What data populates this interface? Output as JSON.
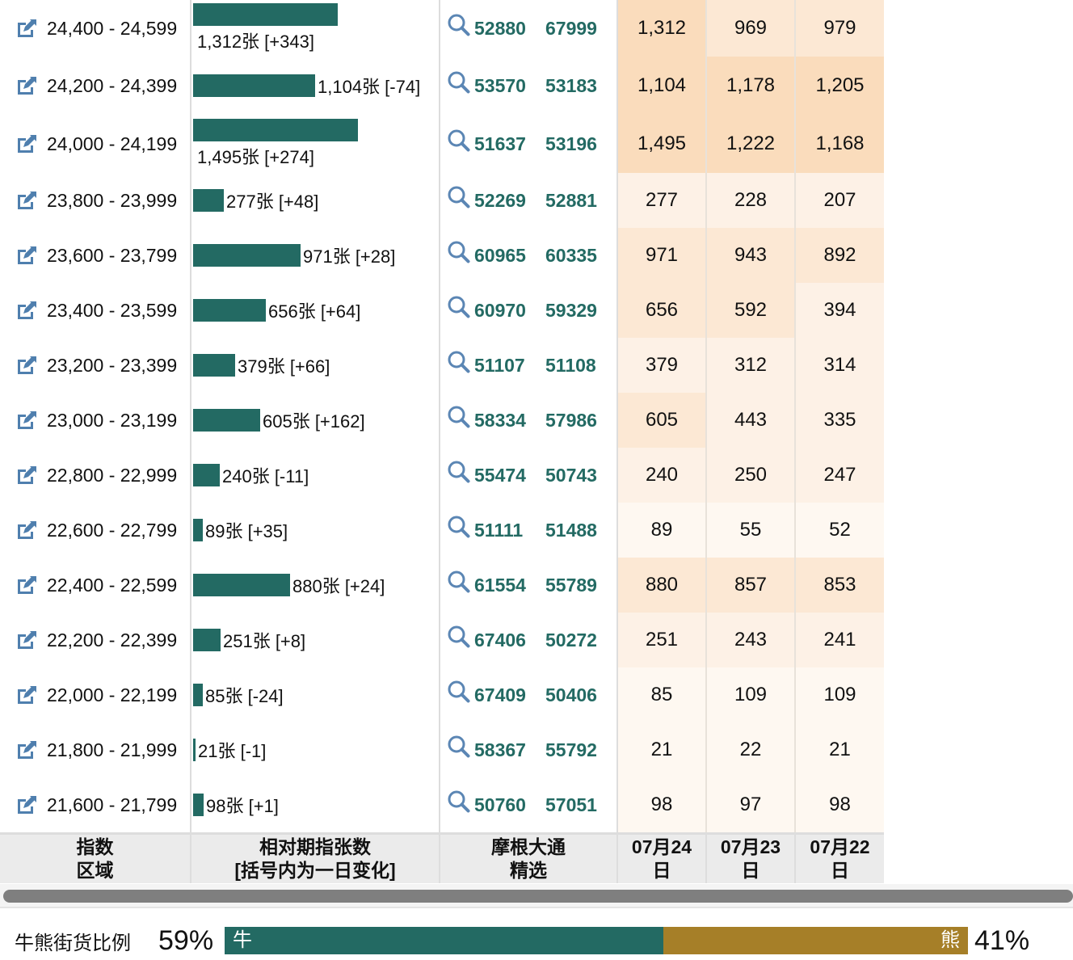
{
  "rows": [
    {
      "range": "24,400 - 24,599",
      "count": 1312,
      "label": "1,312张 [+343]",
      "code1": "52880",
      "code2": "67999",
      "d1": "1,312",
      "d2": "969",
      "d3": "979"
    },
    {
      "range": "24,200 - 24,399",
      "count": 1104,
      "label": "1,104张 [-74]",
      "code1": "53570",
      "code2": "53183",
      "d1": "1,104",
      "d2": "1,178",
      "d3": "1,205"
    },
    {
      "range": "24,000 - 24,199",
      "count": 1495,
      "label": "1,495张 [+274]",
      "code1": "51637",
      "code2": "53196",
      "d1": "1,495",
      "d2": "1,222",
      "d3": "1,168"
    },
    {
      "range": "23,800 - 23,999",
      "count": 277,
      "label": "277张 [+48]",
      "code1": "52269",
      "code2": "52881",
      "d1": "277",
      "d2": "228",
      "d3": "207"
    },
    {
      "range": "23,600 - 23,799",
      "count": 971,
      "label": "971张 [+28]",
      "code1": "60965",
      "code2": "60335",
      "d1": "971",
      "d2": "943",
      "d3": "892"
    },
    {
      "range": "23,400 - 23,599",
      "count": 656,
      "label": "656张 [+64]",
      "code1": "60970",
      "code2": "59329",
      "d1": "656",
      "d2": "592",
      "d3": "394"
    },
    {
      "range": "23,200 - 23,399",
      "count": 379,
      "label": "379张 [+66]",
      "code1": "51107",
      "code2": "51108",
      "d1": "379",
      "d2": "312",
      "d3": "314"
    },
    {
      "range": "23,000 - 23,199",
      "count": 605,
      "label": "605张 [+162]",
      "code1": "58334",
      "code2": "57986",
      "d1": "605",
      "d2": "443",
      "d3": "335"
    },
    {
      "range": "22,800 - 22,999",
      "count": 240,
      "label": "240张 [-11]",
      "code1": "55474",
      "code2": "50743",
      "d1": "240",
      "d2": "250",
      "d3": "247"
    },
    {
      "range": "22,600 - 22,799",
      "count": 89,
      "label": "89张 [+35]",
      "code1": "51111",
      "code2": "51488",
      "d1": "89",
      "d2": "55",
      "d3": "52"
    },
    {
      "range": "22,400 - 22,599",
      "count": 880,
      "label": "880张 [+24]",
      "code1": "61554",
      "code2": "55789",
      "d1": "880",
      "d2": "857",
      "d3": "853"
    },
    {
      "range": "22,200 - 22,399",
      "count": 251,
      "label": "251张 [+8]",
      "code1": "67406",
      "code2": "50272",
      "d1": "251",
      "d2": "243",
      "d3": "241"
    },
    {
      "range": "22,000 - 22,199",
      "count": 85,
      "label": "85张 [-24]",
      "code1": "67409",
      "code2": "50406",
      "d1": "85",
      "d2": "109",
      "d3": "109"
    },
    {
      "range": "21,800 - 21,999",
      "count": 21,
      "label": "21张 [-1]",
      "code1": "58367",
      "code2": "55792",
      "d1": "21",
      "d2": "22",
      "d3": "21"
    },
    {
      "range": "21,600 - 21,799",
      "count": 98,
      "label": "98张 [+1]",
      "code1": "50760",
      "code2": "57051",
      "d1": "98",
      "d2": "97",
      "d3": "98"
    }
  ],
  "header": {
    "col1a": "指数",
    "col1b": "区域",
    "col2a": "相对期指张数",
    "col2b": "[括号内为一日变化]",
    "col3a": "摩根大通",
    "col3b": "精选",
    "d1a": "07月24",
    "d1b": "日",
    "d2a": "07月23",
    "d2b": "日",
    "d3a": "07月22",
    "d3b": "日"
  },
  "ratio": {
    "label": "牛熊街货比例",
    "bull_pct": "59%",
    "bear_pct": "41%",
    "bull_label": "牛",
    "bear_label": "熊",
    "bull_fraction": 0.59
  },
  "colors": {
    "bar": "#236a63",
    "bear": "#a67f28",
    "heat": [
      "#fadcbc",
      "#fce8d4",
      "#fdf1e6",
      "#fef8f1"
    ]
  }
}
